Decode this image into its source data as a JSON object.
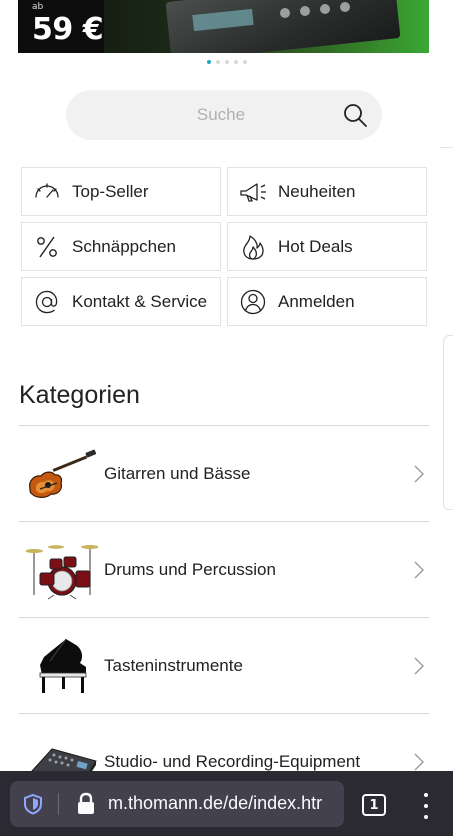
{
  "banner": {
    "price_prefix": "ab",
    "price": "59 €"
  },
  "carousel": {
    "slides": 5,
    "active_index": 0,
    "accent": "#2aa3c9"
  },
  "search": {
    "placeholder": "Suche",
    "icon": "search-icon"
  },
  "quick_links": [
    {
      "label": "Top-Seller",
      "icon": "speedometer-icon"
    },
    {
      "label": "Neuheiten",
      "icon": "megaphone-icon"
    },
    {
      "label": "Schnäppchen",
      "icon": "percent-icon"
    },
    {
      "label": "Hot Deals",
      "icon": "flame-icon"
    },
    {
      "label": "Kontakt & Service",
      "icon": "at-icon"
    },
    {
      "label": "Anmelden",
      "icon": "user-icon"
    }
  ],
  "categories": {
    "title": "Kategorien",
    "items": [
      {
        "name": "Gitarren und Bässe",
        "icon": "guitar-icon"
      },
      {
        "name": "Drums und Percussion",
        "icon": "drumkit-icon"
      },
      {
        "name": "Tasteninstrumente",
        "icon": "piano-icon"
      },
      {
        "name": "Studio- und Recording-Equipment",
        "icon": "mixer-icon"
      }
    ]
  },
  "browser": {
    "url": "m.thomann.de/de/index.htr",
    "tab_count": "1",
    "colors": {
      "bar": "#2b2a33",
      "urlbox": "#42414d",
      "shield": "#8fa8ff"
    }
  }
}
